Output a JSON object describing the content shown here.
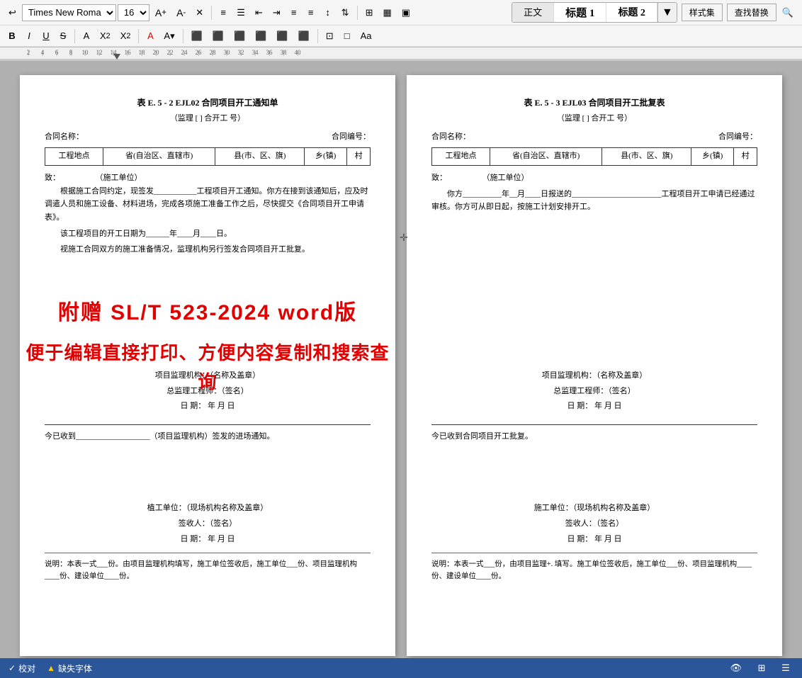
{
  "toolbar": {
    "font_name": "Times New Roma",
    "font_size": "16",
    "style_normal": "正文",
    "style_heading1": "标题 1",
    "style_heading2": "标题 2",
    "style_set_label": "样式集",
    "find_replace_label": "查找替换"
  },
  "ruler": {
    "marks": [
      "2",
      "4",
      "6",
      "8",
      "10",
      "12",
      "14",
      "16",
      "18",
      "20",
      "22",
      "24",
      "26",
      "28",
      "30",
      "32",
      "34",
      "36",
      "38",
      "40"
    ]
  },
  "left_doc": {
    "title": "表 E. 5 - 2   EJL02   合同项目开工通知单",
    "subtitle": "（监理 [    ] 合开工     号）",
    "contract_name_label": "合同名称：",
    "contract_no_label": "合同编号：",
    "table_headers": [
      "工程地点",
      "省(自治区、直辖市)",
      "县(市、区、旗)",
      "乡(镇)",
      "村"
    ],
    "to_label": "致：",
    "construction_unit": "（施工单位）",
    "para1": "根据施工合同约定，现签发___________工程项目开工通知。你方在接到该通知后，应及时调遣人员和施工设备、材料进场，完成各项施工准备工作之后，尽快提交《合同项目开工申请表》。",
    "para2": "该工程项目的开工日期为______年____月____日。",
    "para3": "视施工合同双方的施工准备情况，监理机构另行签发合同项目开工批复。",
    "supervisor_org": "项目监理机构：（名称及盖章）",
    "chief_engineer": "总监理工程师：（签名）",
    "date_label": "日     期：",
    "date_value": "年    月    日",
    "reception_text": "今已收到___________________（项目监理机构）签发的进场通知。",
    "contractor_label": "植工单位：（现场机构名称及盖章）",
    "signatory_label": "签收人：（签名）",
    "date2_label": "日    期：",
    "date2_value": "年    月    日",
    "note": "说明：本表一式___份。由项目监理机构填写，施工单位签收后，施工单位___份、项目监理机构____份、建设单位____份。"
  },
  "right_doc": {
    "title": "表 E. 5 - 3   EJL03   合同项目开工批复表",
    "subtitle": "（监理 [  ] 合开工    号）",
    "contract_name_label": "合同名称：",
    "contract_no_label": "合同编号：",
    "table_headers": [
      "工程地点",
      "省(自治区、直辖市)",
      "县(市、区、旗)",
      "乡(镇)",
      "村"
    ],
    "to_label": "致：",
    "construction_unit": "（施工单位）",
    "para1": "你方__________年__月____日报送的_______________________工程项目开工申请已经通过审核。你方可从即日起，按施工计划安排开工。",
    "supervisor_org": "项目监理机构：（名称及盖章）",
    "chief_engineer": "总监理工程师：（签名）",
    "date_label": "日     期：",
    "date_value": "年    月    日",
    "reception_text": "今已收到合同项目开工批复。",
    "contractor_label": "施工单位：（现场机构名称及盖章）",
    "signatory_label": "签收人：（签名）",
    "date2_label": "日    期：",
    "date2_value": "年    月    日",
    "note": "说明：本表一式___份，由项目监理+. 填写。施工单位签收后，施工单位___份、项目监理机构____份、建设单位____份。"
  },
  "watermark": {
    "line1": "附赠 SL/T 523-2024 word版",
    "line2": "便于编辑直接打印、方便内容复制和搜索查询"
  },
  "status_bar": {
    "proofread": "校对",
    "missing_font": "缺失字体",
    "warning_icon": "▲"
  }
}
